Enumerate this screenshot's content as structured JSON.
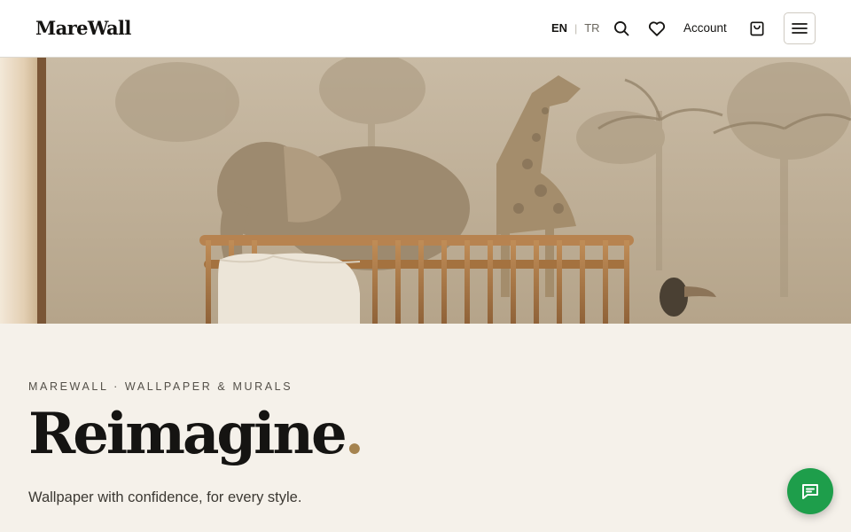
{
  "header": {
    "logo": "MareWall",
    "lang_active": "EN",
    "lang_separator": "|",
    "lang_other": "TR",
    "account_label": "Account",
    "icons": [
      "search-icon",
      "heart-icon",
      "cart-icon",
      "menu-icon"
    ]
  },
  "hero": {
    "icon": "nursery-mural-image"
  },
  "intro": {
    "eyebrow": "MAREWALL · WALLPAPER & MURALS",
    "headline": "Reimagine",
    "headline_dot": ".",
    "subtitle": "Wallpaper with confidence, for every style."
  },
  "chat": {
    "icon": "chat-icon",
    "color": "#1e9e4b"
  },
  "colors": {
    "accent": "#a5834f",
    "background": "#f5f1ea"
  }
}
